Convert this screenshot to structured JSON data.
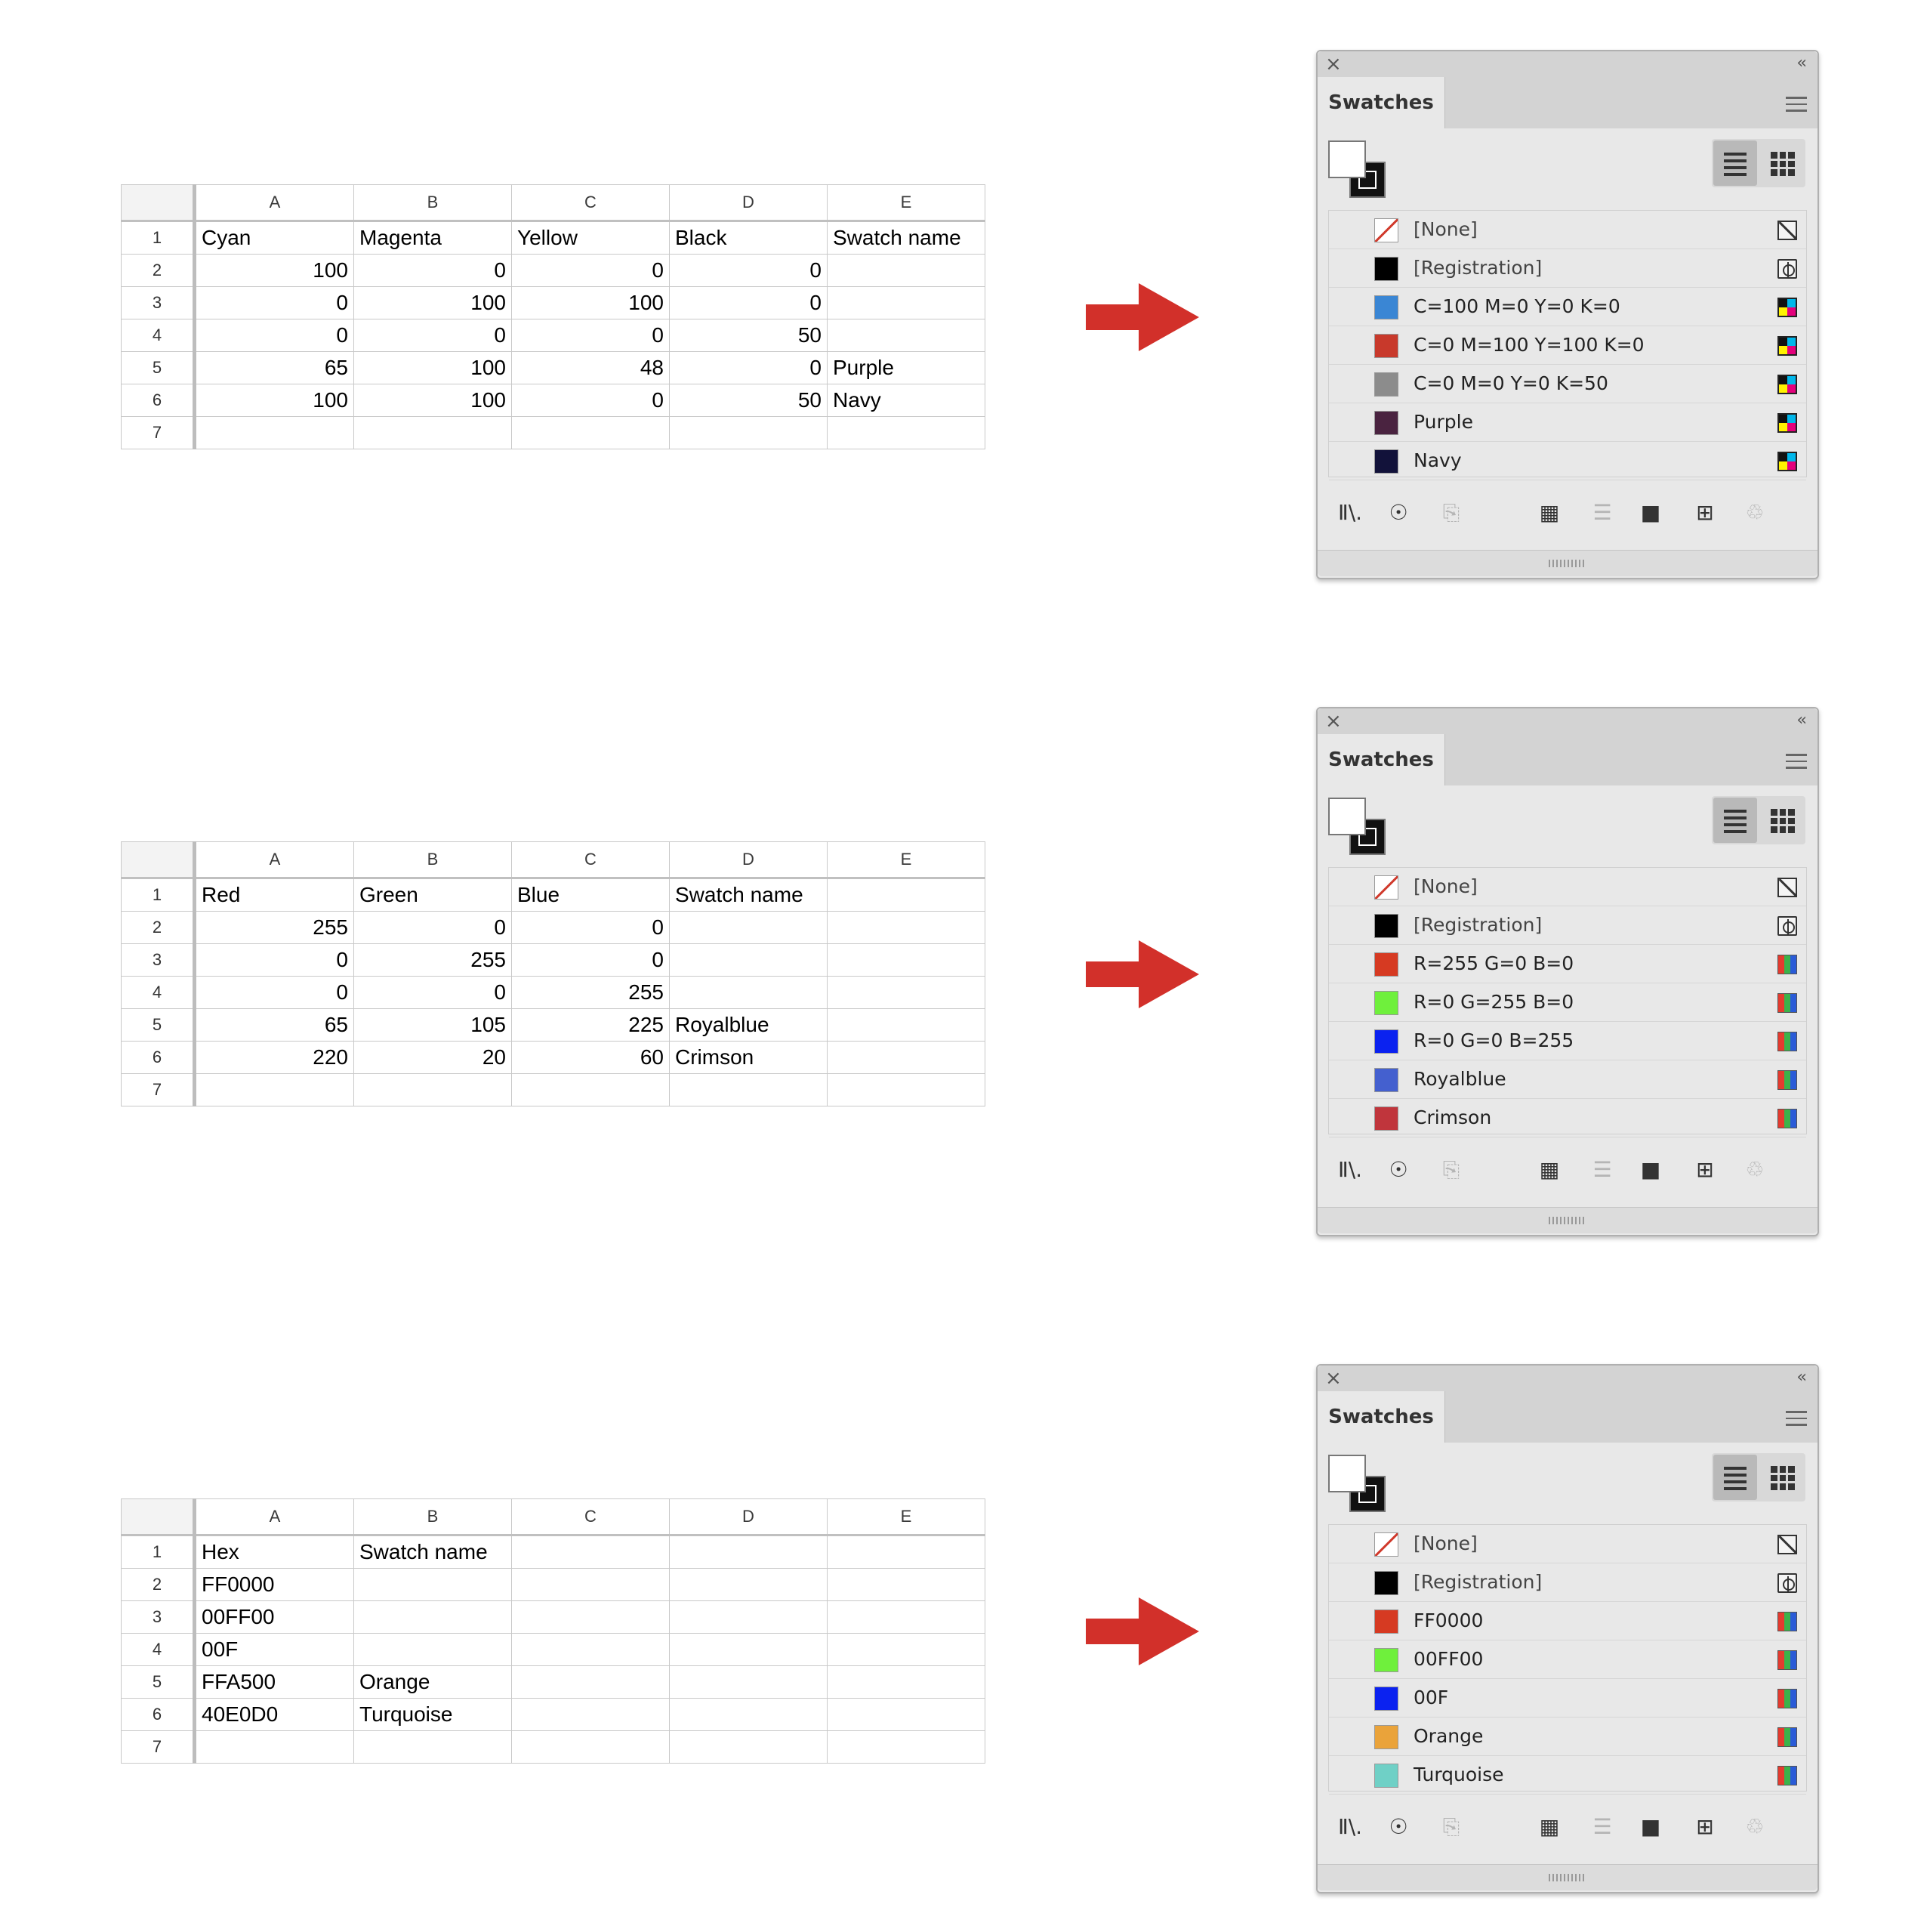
{
  "columns": [
    "A",
    "B",
    "C",
    "D",
    "E"
  ],
  "row_numbers": [
    "1",
    "2",
    "3",
    "4",
    "5",
    "6",
    "7"
  ],
  "blocks": [
    {
      "sheet": [
        [
          {
            "v": "Cyan",
            "t": "txt"
          },
          {
            "v": "Magenta",
            "t": "txt"
          },
          {
            "v": "Yellow",
            "t": "txt"
          },
          {
            "v": "Black",
            "t": "txt"
          },
          {
            "v": "Swatch name",
            "t": "txt"
          }
        ],
        [
          {
            "v": "100",
            "t": "num"
          },
          {
            "v": "0",
            "t": "num"
          },
          {
            "v": "0",
            "t": "num"
          },
          {
            "v": "0",
            "t": "num"
          },
          {
            "v": "",
            "t": "txt"
          }
        ],
        [
          {
            "v": "0",
            "t": "num"
          },
          {
            "v": "100",
            "t": "num"
          },
          {
            "v": "100",
            "t": "num"
          },
          {
            "v": "0",
            "t": "num"
          },
          {
            "v": "",
            "t": "txt"
          }
        ],
        [
          {
            "v": "0",
            "t": "num"
          },
          {
            "v": "0",
            "t": "num"
          },
          {
            "v": "0",
            "t": "num"
          },
          {
            "v": "50",
            "t": "num"
          },
          {
            "v": "",
            "t": "txt"
          }
        ],
        [
          {
            "v": "65",
            "t": "num"
          },
          {
            "v": "100",
            "t": "num"
          },
          {
            "v": "48",
            "t": "num"
          },
          {
            "v": "0",
            "t": "num"
          },
          {
            "v": "Purple",
            "t": "txt"
          }
        ],
        [
          {
            "v": "100",
            "t": "num"
          },
          {
            "v": "100",
            "t": "num"
          },
          {
            "v": "0",
            "t": "num"
          },
          {
            "v": "50",
            "t": "num"
          },
          {
            "v": "Navy",
            "t": "txt"
          }
        ],
        [
          {
            "v": "",
            "t": "txt"
          },
          {
            "v": "",
            "t": "txt"
          },
          {
            "v": "",
            "t": "txt"
          },
          {
            "v": "",
            "t": "txt"
          },
          {
            "v": "",
            "t": "txt"
          }
        ]
      ],
      "panel": {
        "title": "Swatches",
        "swatches": [
          {
            "name": "[None]",
            "color": "none",
            "type": "none",
            "system": true
          },
          {
            "name": "[Registration]",
            "color": "#000000",
            "type": "registration",
            "system": true
          },
          {
            "name": "C=100 M=0 Y=0 K=0",
            "color": "#3a86d4",
            "type": "cmyk"
          },
          {
            "name": "C=0 M=100 Y=100 K=0",
            "color": "#c8392b",
            "type": "cmyk"
          },
          {
            "name": "C=0 M=0 Y=0 K=50",
            "color": "#8c8c8c",
            "type": "cmyk"
          },
          {
            "name": "Purple",
            "color": "#4a2340",
            "type": "cmyk"
          },
          {
            "name": "Navy",
            "color": "#12123a",
            "type": "cmyk"
          }
        ]
      }
    },
    {
      "sheet": [
        [
          {
            "v": "Red",
            "t": "txt"
          },
          {
            "v": "Green",
            "t": "txt"
          },
          {
            "v": "Blue",
            "t": "txt"
          },
          {
            "v": "Swatch name",
            "t": "txt"
          },
          {
            "v": "",
            "t": "txt"
          }
        ],
        [
          {
            "v": "255",
            "t": "num"
          },
          {
            "v": "0",
            "t": "num"
          },
          {
            "v": "0",
            "t": "num"
          },
          {
            "v": "",
            "t": "txt"
          },
          {
            "v": "",
            "t": "txt"
          }
        ],
        [
          {
            "v": "0",
            "t": "num"
          },
          {
            "v": "255",
            "t": "num"
          },
          {
            "v": "0",
            "t": "num"
          },
          {
            "v": "",
            "t": "txt"
          },
          {
            "v": "",
            "t": "txt"
          }
        ],
        [
          {
            "v": "0",
            "t": "num"
          },
          {
            "v": "0",
            "t": "num"
          },
          {
            "v": "255",
            "t": "num"
          },
          {
            "v": "",
            "t": "txt"
          },
          {
            "v": "",
            "t": "txt"
          }
        ],
        [
          {
            "v": "65",
            "t": "num"
          },
          {
            "v": "105",
            "t": "num"
          },
          {
            "v": "225",
            "t": "num"
          },
          {
            "v": "Royalblue",
            "t": "txt"
          },
          {
            "v": "",
            "t": "txt"
          }
        ],
        [
          {
            "v": "220",
            "t": "num"
          },
          {
            "v": "20",
            "t": "num"
          },
          {
            "v": "60",
            "t": "num"
          },
          {
            "v": "Crimson",
            "t": "txt"
          },
          {
            "v": "",
            "t": "txt"
          }
        ],
        [
          {
            "v": "",
            "t": "txt"
          },
          {
            "v": "",
            "t": "txt"
          },
          {
            "v": "",
            "t": "txt"
          },
          {
            "v": "",
            "t": "txt"
          },
          {
            "v": "",
            "t": "txt"
          }
        ]
      ],
      "panel": {
        "title": "Swatches",
        "swatches": [
          {
            "name": "[None]",
            "color": "none",
            "type": "none",
            "system": true
          },
          {
            "name": "[Registration]",
            "color": "#000000",
            "type": "registration",
            "system": true
          },
          {
            "name": "R=255 G=0 B=0",
            "color": "#d63a22",
            "type": "rgb"
          },
          {
            "name": "R=0 G=255 B=0",
            "color": "#6ff03c",
            "type": "rgb"
          },
          {
            "name": "R=0 G=0 B=255",
            "color": "#0b22f0",
            "type": "rgb"
          },
          {
            "name": "Royalblue",
            "color": "#4460cf",
            "type": "rgb"
          },
          {
            "name": "Crimson",
            "color": "#c0353c",
            "type": "rgb"
          }
        ]
      }
    },
    {
      "sheet": [
        [
          {
            "v": "Hex",
            "t": "txt"
          },
          {
            "v": "Swatch name",
            "t": "txt"
          },
          {
            "v": "",
            "t": "txt"
          },
          {
            "v": "",
            "t": "txt"
          },
          {
            "v": "",
            "t": "txt"
          }
        ],
        [
          {
            "v": "FF0000",
            "t": "txt"
          },
          {
            "v": "",
            "t": "txt"
          },
          {
            "v": "",
            "t": "txt"
          },
          {
            "v": "",
            "t": "txt"
          },
          {
            "v": "",
            "t": "txt"
          }
        ],
        [
          {
            "v": "00FF00",
            "t": "txt"
          },
          {
            "v": "",
            "t": "txt"
          },
          {
            "v": "",
            "t": "txt"
          },
          {
            "v": "",
            "t": "txt"
          },
          {
            "v": "",
            "t": "txt"
          }
        ],
        [
          {
            "v": "00F",
            "t": "txt"
          },
          {
            "v": "",
            "t": "txt"
          },
          {
            "v": "",
            "t": "txt"
          },
          {
            "v": "",
            "t": "txt"
          },
          {
            "v": "",
            "t": "txt"
          }
        ],
        [
          {
            "v": "FFA500",
            "t": "txt"
          },
          {
            "v": "Orange",
            "t": "txt"
          },
          {
            "v": "",
            "t": "txt"
          },
          {
            "v": "",
            "t": "txt"
          },
          {
            "v": "",
            "t": "txt"
          }
        ],
        [
          {
            "v": "40E0D0",
            "t": "txt"
          },
          {
            "v": "Turquoise",
            "t": "txt"
          },
          {
            "v": "",
            "t": "txt"
          },
          {
            "v": "",
            "t": "txt"
          },
          {
            "v": "",
            "t": "txt"
          }
        ],
        [
          {
            "v": "",
            "t": "txt"
          },
          {
            "v": "",
            "t": "txt"
          },
          {
            "v": "",
            "t": "txt"
          },
          {
            "v": "",
            "t": "txt"
          },
          {
            "v": "",
            "t": "txt"
          }
        ]
      ],
      "panel": {
        "title": "Swatches",
        "swatches": [
          {
            "name": "[None]",
            "color": "none",
            "type": "none",
            "system": true
          },
          {
            "name": "[Registration]",
            "color": "#000000",
            "type": "registration",
            "system": true
          },
          {
            "name": "FF0000",
            "color": "#d63a22",
            "type": "rgb"
          },
          {
            "name": "00FF00",
            "color": "#6ff03c",
            "type": "rgb"
          },
          {
            "name": "00F",
            "color": "#0b22f0",
            "type": "rgb"
          },
          {
            "name": "Orange",
            "color": "#eaa33a",
            "type": "rgb"
          },
          {
            "name": "Turquoise",
            "color": "#6fd0c6",
            "type": "rgb"
          }
        ]
      }
    }
  ],
  "panel_controls": {
    "close_icon": "×",
    "collapse_icon": "‹‹",
    "bottom_icons": [
      {
        "name": "swatch-libraries-menu-icon",
        "glyph": "Ⅱ\\.",
        "dim": false
      },
      {
        "name": "show-swatch-kinds-icon",
        "glyph": "☉",
        "dim": false
      },
      {
        "name": "import-swatches-icon",
        "glyph": "⎘",
        "dim": true
      },
      {
        "name": "swatch-options-icon",
        "glyph": "▦",
        "dim": false
      },
      {
        "name": "color-group-options-icon",
        "glyph": "☰",
        "dim": true
      },
      {
        "name": "new-color-group-icon",
        "glyph": "■",
        "dim": false
      },
      {
        "name": "new-swatch-icon",
        "glyph": "⊞",
        "dim": false
      },
      {
        "name": "delete-swatch-icon",
        "glyph": "♲",
        "dim": true
      }
    ]
  },
  "colors": {
    "arrow": "#d2302a"
  }
}
